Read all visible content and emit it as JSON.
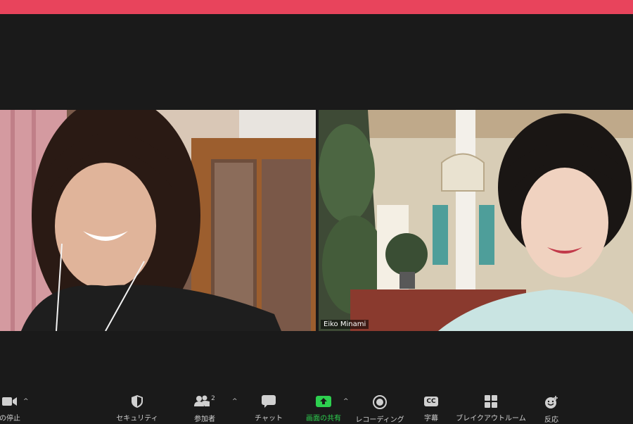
{
  "participants": [
    {
      "name": ""
    },
    {
      "name": "Eiko Minami"
    }
  ],
  "toolbar": {
    "video": {
      "label": "の停止",
      "icon": "video-camera-icon"
    },
    "security": {
      "label": "セキュリティ",
      "icon": "shield-icon"
    },
    "participants": {
      "label": "参加者",
      "count": "2",
      "icon": "people-icon"
    },
    "chat": {
      "label": "チャット",
      "icon": "chat-bubble-icon"
    },
    "share": {
      "label": "画面の共有",
      "icon": "share-screen-icon"
    },
    "record": {
      "label": "レコーディング",
      "icon": "record-icon"
    },
    "captions": {
      "label": "字幕",
      "badge": "CC",
      "icon": "cc-icon"
    },
    "breakout": {
      "label": "ブレイクアウトルーム",
      "icon": "grid-icon"
    },
    "reactions": {
      "label": "反応",
      "icon": "emoji-icon"
    }
  },
  "colors": {
    "top_bar": "#e8445c",
    "background": "#1a1a1a",
    "share_green": "#2dd04f"
  }
}
